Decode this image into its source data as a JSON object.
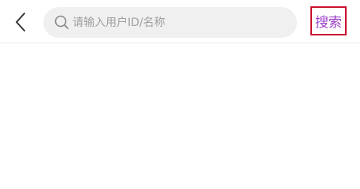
{
  "header": {
    "back_icon": "chevron-left-icon",
    "search": {
      "icon": "search-icon",
      "placeholder": "请输入用户ID/名称",
      "value": ""
    },
    "submit_label": "搜索"
  },
  "colors": {
    "accent": "#9b3fc7",
    "highlight_border": "#c8102e",
    "search_bg": "#f0f0f0",
    "placeholder": "#a0a0a0"
  }
}
